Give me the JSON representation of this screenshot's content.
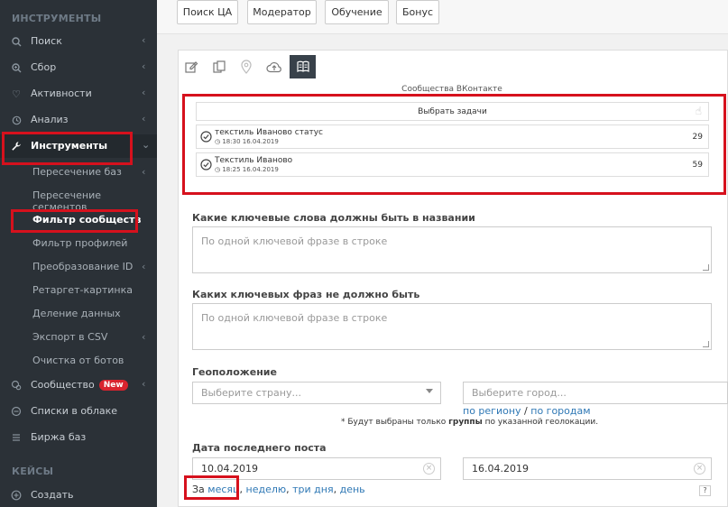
{
  "sidebar": {
    "section_tools": "ИНСТРУМЕНТЫ",
    "items": [
      {
        "label": "Поиск",
        "icon": "search-icon"
      },
      {
        "label": "Сбор",
        "icon": "zoom-icon"
      },
      {
        "label": "Активности",
        "icon": "heart-icon"
      },
      {
        "label": "Анализ",
        "icon": "history-icon"
      },
      {
        "label": "Инструменты",
        "icon": "wrench-icon"
      }
    ],
    "subitems": [
      {
        "label": "Пересечение баз"
      },
      {
        "label": "Пересечение сегментов"
      },
      {
        "label": "Фильтр сообществ"
      },
      {
        "label": "Фильтр профилей"
      },
      {
        "label": "Преобразование ID"
      },
      {
        "label": "Ретаргет-картинка"
      },
      {
        "label": "Деление данных"
      },
      {
        "label": "Экспорт в CSV"
      },
      {
        "label": "Очистка от ботов"
      }
    ],
    "items2": [
      {
        "label": "Сообщество",
        "badge": "New",
        "icon": "community-icon"
      },
      {
        "label": "Списки в облаке",
        "icon": "cloud-list-icon"
      },
      {
        "label": "Биржа баз",
        "icon": "list-icon"
      }
    ],
    "section_cases": "КЕЙСЫ",
    "create": {
      "label": "Создать",
      "icon": "plus-circle-icon"
    }
  },
  "tabs": [
    "Поиск ЦА",
    "Модератор",
    "Обучение",
    "Бонус"
  ],
  "tools": [
    "edit-icon",
    "copy-icon",
    "location-icon",
    "cloud-upload-icon",
    "book-icon"
  ],
  "source_label": "Сообщества ВКонтакте",
  "select_tasks_label": "Выбрать задачи",
  "tasks": [
    {
      "name": "текстиль Иваново статус",
      "time": "18:30 16.04.2019",
      "count": "29"
    },
    {
      "name": "Текстиль Иваново",
      "time": "18:25 16.04.2019",
      "count": "59"
    }
  ],
  "keywords": {
    "label": "Какие ключевые слова должны быть в названии",
    "placeholder": "По одной ключевой фразе в строке"
  },
  "exclude": {
    "label": "Каких ключевых фраз не должно быть",
    "placeholder": "По одной ключевой фразе в строке"
  },
  "geo": {
    "label": "Геоположение",
    "country_placeholder": "Выберите страну...",
    "city_placeholder": "Выберите город...",
    "by_region": "по региону",
    "separator": "/",
    "by_cities": "по городам",
    "note_prefix": "* Будут выбраны только ",
    "note_bold": "группы",
    "note_suffix": " по указанной геолокации."
  },
  "last_post": {
    "label": "Дата последнего поста",
    "date_from": "10.04.2019",
    "date_to": "16.04.2019",
    "period_prefix": "За",
    "period_month": "месяц",
    "period_week": "неделю",
    "period_three_days": "три дня",
    "period_day": "день",
    "help": "?"
  }
}
